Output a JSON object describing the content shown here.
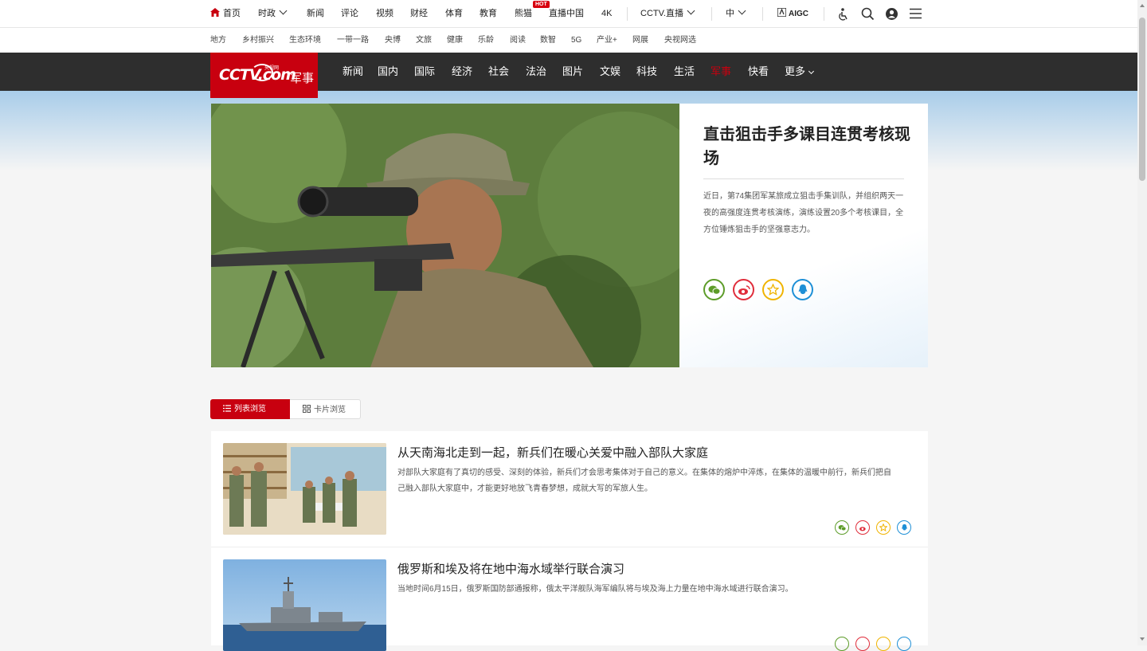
{
  "topbar": {
    "home": "首页",
    "items": [
      "时政",
      "新闻",
      "评论",
      "视频",
      "财经",
      "体育",
      "教育",
      "熊猫",
      "直播中国",
      "4K"
    ],
    "hot_badge": "HOT",
    "live": "CCTV.直播",
    "lang": "中",
    "aigc": "AIGC"
  },
  "subnav": [
    "地方",
    "乡村振兴",
    "生态环境",
    "一带一路",
    "央博",
    "文旅",
    "健康",
    "乐龄",
    "阅读",
    "数智",
    "5G",
    "产业+",
    "网展",
    "央视网选"
  ],
  "logo": {
    "brand": "CCTV.com",
    "cn": "央视网",
    "channel": "军事"
  },
  "mainnav": [
    "新闻",
    "国内",
    "国际",
    "经济",
    "社会",
    "法治",
    "图片",
    "文娱",
    "科技",
    "生活",
    "军事",
    "快看",
    "更多"
  ],
  "hero": {
    "title": "直击狙击手多课目连贯考核现场",
    "desc": "近日，第74集团军某旅成立狙击手集训队，并组织两天一夜的高强度连贯考核演练，演练设置20多个考核课目，全方位锤炼狙击手的坚强意志力。"
  },
  "view_toggle": {
    "list": "列表浏览",
    "card": "卡片浏览"
  },
  "articles": [
    {
      "title": "从天南海北走到一起，新兵们在暖心关爱中融入部队大家庭",
      "desc": "对部队大家庭有了真切的感受、深刻的体验，新兵们才会思考集体对于自己的意义。在集体的熔炉中淬炼，在集体的温暖中前行，新兵们把自己融入部队大家庭中，才能更好地放飞青春梦想，成就大写的军旅人生。"
    },
    {
      "title": "俄罗斯和埃及将在地中海水域举行联合演习",
      "desc": "当地时间6月15日，俄罗斯国防部通报称，俄太平洋舰队海军编队将与埃及海上力量在地中海水域进行联合演习。"
    }
  ],
  "colors": {
    "brand_red": "#c8000f",
    "nav_bg": "#2e2e2e",
    "wechat": "#5d9c29",
    "weibo": "#e02d3b",
    "favorite": "#f0b400",
    "qq": "#1d8fd6"
  },
  "icons": [
    "home-icon",
    "accessibility-icon",
    "search-icon",
    "user-icon",
    "menu-icon",
    "wechat-icon",
    "weibo-icon",
    "favorite-icon",
    "qq-icon",
    "list-icon",
    "grid-icon"
  ]
}
